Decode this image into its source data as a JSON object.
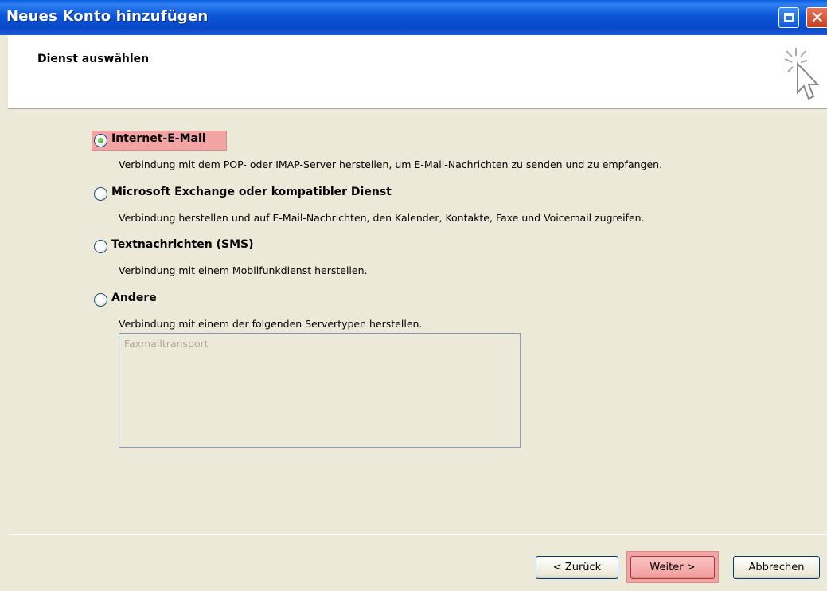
{
  "window": {
    "title": "Neues Konto hinzufügen"
  },
  "header": {
    "title": "Dienst auswählen",
    "icon": "wizard-cursor-icon"
  },
  "options": [
    {
      "label": "Internet-E-Mail",
      "description": "Verbindung mit dem POP- oder IMAP-Server herstellen, um E-Mail-Nachrichten zu senden und zu empfangen.",
      "selected": true
    },
    {
      "label": "Microsoft Exchange oder kompatibler Dienst",
      "description": "Verbindung herstellen und auf E-Mail-Nachrichten, den Kalender, Kontakte, Faxe und Voicemail zugreifen.",
      "selected": false
    },
    {
      "label": "Textnachrichten (SMS)",
      "description": "Verbindung mit einem Mobilfunkdienst herstellen.",
      "selected": false
    },
    {
      "label": "Andere",
      "description": "Verbindung mit einem der folgenden Servertypen herstellen.",
      "selected": false
    }
  ],
  "server_types": [
    "Faxmailtransport"
  ],
  "buttons": {
    "back": "< Zurück",
    "next": "Weiter >",
    "cancel": "Abbrechen"
  },
  "colors": {
    "highlight": "#f2a3a3",
    "titlebar": "#0b56d8",
    "dialog_bg": "#ece9d8"
  }
}
